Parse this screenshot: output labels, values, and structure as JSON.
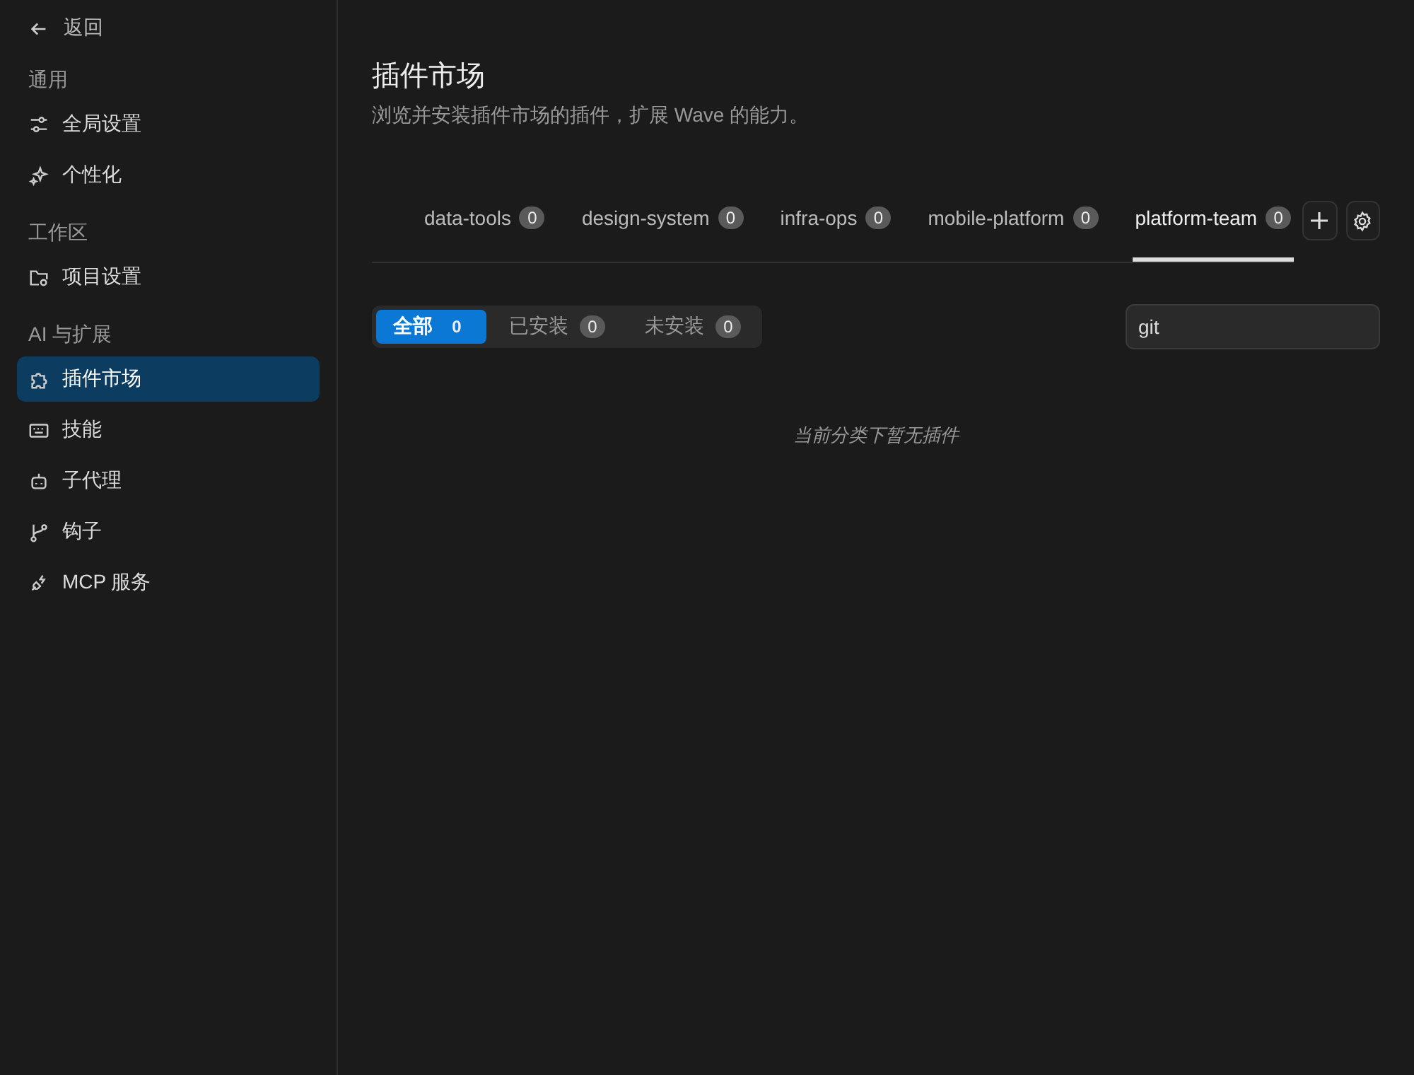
{
  "sidebar": {
    "back": "返回",
    "sections": [
      {
        "title": "通用",
        "items": [
          {
            "label": "全局设置",
            "kind": "sliders",
            "selected": false
          },
          {
            "label": "个性化",
            "kind": "sparkle",
            "selected": false
          }
        ]
      },
      {
        "title": "工作区",
        "items": [
          {
            "label": "项目设置",
            "kind": "folder",
            "selected": false
          }
        ]
      },
      {
        "title": "AI 与扩展",
        "items": [
          {
            "label": "插件市场",
            "kind": "puzzle",
            "selected": true
          },
          {
            "label": "技能",
            "kind": "keyboard",
            "selected": false
          },
          {
            "label": "子代理",
            "kind": "robot",
            "selected": false
          },
          {
            "label": "钩子",
            "kind": "branch",
            "selected": false
          },
          {
            "label": "MCP 服务",
            "kind": "plug",
            "selected": false
          }
        ]
      }
    ]
  },
  "page": {
    "title": "插件市场",
    "subtitle": "浏览并安装插件市场的插件，扩展 Wave 的能力。"
  },
  "tabs": [
    {
      "label": "data-tools",
      "count": "0",
      "selected": false
    },
    {
      "label": "design-system",
      "count": "0",
      "selected": false
    },
    {
      "label": "infra-ops",
      "count": "0",
      "selected": false
    },
    {
      "label": "mobile-platform",
      "count": "0",
      "selected": false
    },
    {
      "label": "platform-team",
      "count": "0",
      "selected": true
    }
  ],
  "filters": [
    {
      "label": "全部",
      "count": "0",
      "selected": true
    },
    {
      "label": "已安装",
      "count": "0",
      "selected": false
    },
    {
      "label": "未安装",
      "count": "0",
      "selected": false
    }
  ],
  "search": {
    "value": "git"
  },
  "empty_message": "当前分类下暂无插件"
}
